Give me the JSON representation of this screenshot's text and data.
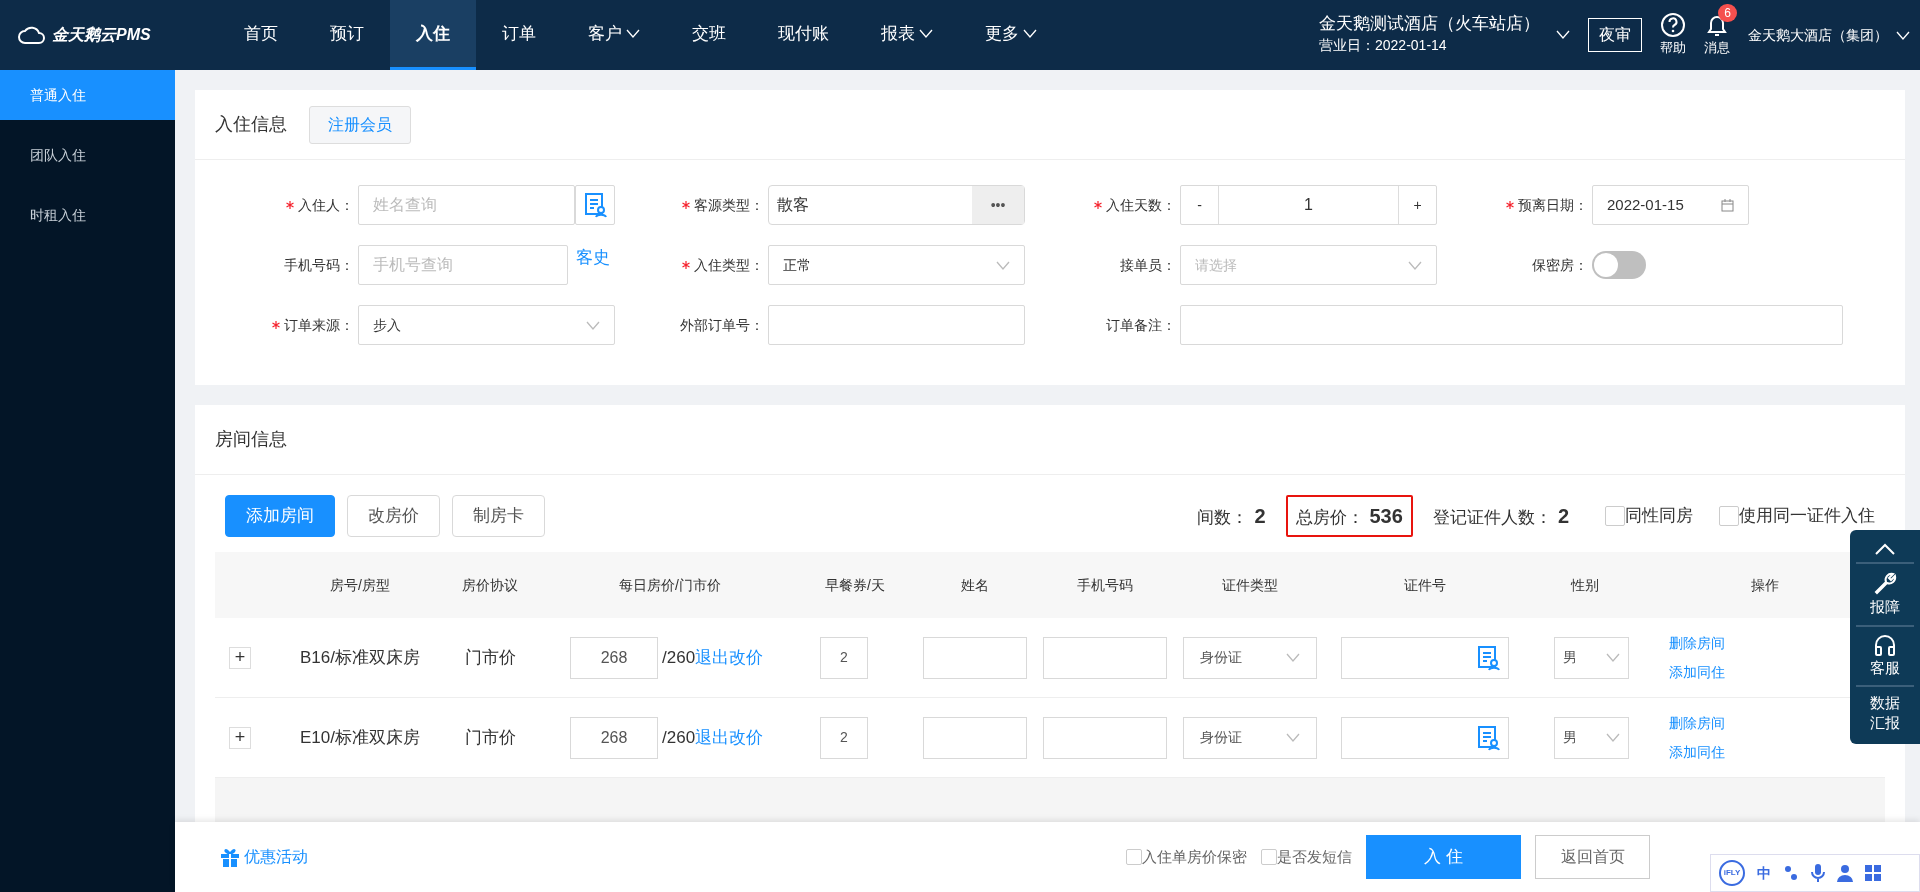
{
  "nav": {
    "logo": "金天鹅云PMS",
    "items": [
      {
        "label": "首页",
        "selected": false,
        "dropdown": false
      },
      {
        "label": "预订",
        "selected": false,
        "dropdown": false
      },
      {
        "label": "入住",
        "selected": true,
        "dropdown": false
      },
      {
        "label": "订单",
        "selected": false,
        "dropdown": false
      },
      {
        "label": "客户",
        "selected": false,
        "dropdown": true
      },
      {
        "label": "交班",
        "selected": false,
        "dropdown": false
      },
      {
        "label": "现付账",
        "selected": false,
        "dropdown": false
      },
      {
        "label": "报表",
        "selected": false,
        "dropdown": true
      },
      {
        "label": "更多",
        "selected": false,
        "dropdown": true
      }
    ],
    "hotel": "金天鹅测试酒店（火车站店）",
    "business_date": "营业日：2022-01-14",
    "night_audit": "夜审",
    "help": "帮助",
    "messages": {
      "label": "消息",
      "badge": "6"
    },
    "account": "金天鹅大酒店（集团）"
  },
  "sidebar": {
    "items": [
      {
        "label": "普通入住",
        "selected": true
      },
      {
        "label": "团队入住",
        "selected": false
      },
      {
        "label": "时租入住",
        "selected": false
      }
    ]
  },
  "checkin_info": {
    "title": "入住信息",
    "register_button": "注册会员",
    "fields": [
      {
        "kind": "lookup",
        "label": "入住人：",
        "required": true,
        "placeholder": "姓名查询"
      },
      {
        "kind": "picker",
        "label": "客源类型：",
        "required": true,
        "value": "散客",
        "button": "•••"
      },
      {
        "kind": "stepper",
        "label": "入住天数：",
        "required": true,
        "value": "1",
        "minus": "-",
        "plus": "+"
      },
      {
        "kind": "date",
        "label": "预离日期：",
        "required": true,
        "value": "2022-01-15"
      },
      {
        "kind": "link_input",
        "label": "手机号码：",
        "required": false,
        "placeholder": "手机号查询",
        "link": "客史"
      },
      {
        "kind": "select",
        "label": "入住类型：",
        "required": true,
        "value": "正常"
      },
      {
        "kind": "select",
        "label": "接单员：",
        "required": false,
        "placeholder": "请选择"
      },
      {
        "kind": "toggle",
        "label": "保密房：",
        "required": false,
        "on": false
      },
      {
        "kind": "select",
        "label": "订单来源：",
        "required": true,
        "value": "步入"
      },
      {
        "kind": "text",
        "label": "外部订单号：",
        "required": false
      },
      {
        "kind": "wide_text",
        "label": "订单备注：",
        "required": false
      }
    ]
  },
  "room_info": {
    "title": "房间信息",
    "buttons": [
      {
        "label": "添加房间",
        "primary": true
      },
      {
        "label": "改房价",
        "primary": false
      },
      {
        "label": "制房卡",
        "primary": false
      }
    ],
    "summary": [
      {
        "label": "间数：",
        "value": "2",
        "highlighted": false
      },
      {
        "label": "总房价：",
        "value": "536",
        "highlighted": true
      },
      {
        "label": "登记证件人数：",
        "value": "2",
        "highlighted": false
      }
    ],
    "options": [
      {
        "label": "同性同房",
        "checked": false
      },
      {
        "label": "使用同一证件入住",
        "checked": false
      }
    ],
    "table": {
      "columns": [
        "房号/房型",
        "房价协议",
        "每日房价/门市价",
        "早餐券/天",
        "姓名",
        "手机号码",
        "证件类型",
        "证件号",
        "性别",
        "操作"
      ],
      "rows": [
        {
          "expand": "+",
          "room": "B16/标准双床房",
          "agreement": "门市价",
          "price": "268",
          "rack": "/260",
          "price_link": "退出改价",
          "breakfast": "2",
          "id_type": "身份证",
          "gender": "男",
          "actions": [
            "删除房间",
            "添加同住"
          ]
        },
        {
          "expand": "+",
          "room": "E10/标准双床房",
          "agreement": "门市价",
          "price": "268",
          "rack": "/260",
          "price_link": "退出改价",
          "breakfast": "2",
          "id_type": "身份证",
          "gender": "男",
          "actions": [
            "删除房间",
            "添加同住"
          ]
        }
      ]
    }
  },
  "side_panel": [
    {
      "kind": "up"
    },
    {
      "kind": "wrench",
      "label": "报障"
    },
    {
      "kind": "headset",
      "label": "客服"
    },
    {
      "kind": "text",
      "label": "数据汇报"
    }
  ],
  "footer": {
    "promo": "优惠活动",
    "options": [
      {
        "label": "入住单房价保密",
        "checked": false
      },
      {
        "label": "是否发短信",
        "checked": false
      }
    ],
    "submit": "入 住",
    "back": "返回首页"
  },
  "ime": {
    "brand": "iFLY",
    "mode": "中"
  }
}
